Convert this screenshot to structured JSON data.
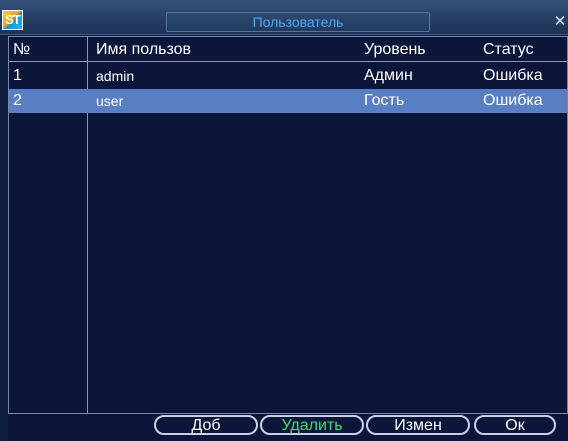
{
  "app": {
    "logo_text": "ST",
    "title": "Пользователь",
    "close_symbol": "✕"
  },
  "table": {
    "headers": {
      "no": "№",
      "name": "Имя пользов",
      "level": "Уровень",
      "status": "Статус"
    },
    "rows": [
      {
        "no": "1",
        "name": "admin",
        "level": "Админ",
        "status": "Ошибка",
        "selected": false
      },
      {
        "no": "2",
        "name": "user",
        "level": "Гость",
        "status": "Ошибка",
        "selected": true
      }
    ]
  },
  "buttons": {
    "add": "Доб",
    "delete": "Удалить",
    "edit": "Измен",
    "ok": "Ок"
  },
  "colors": {
    "selected_row": "#5a7ec4",
    "active_button_text": "#3ee06a",
    "title_text": "#4ea6f5"
  }
}
